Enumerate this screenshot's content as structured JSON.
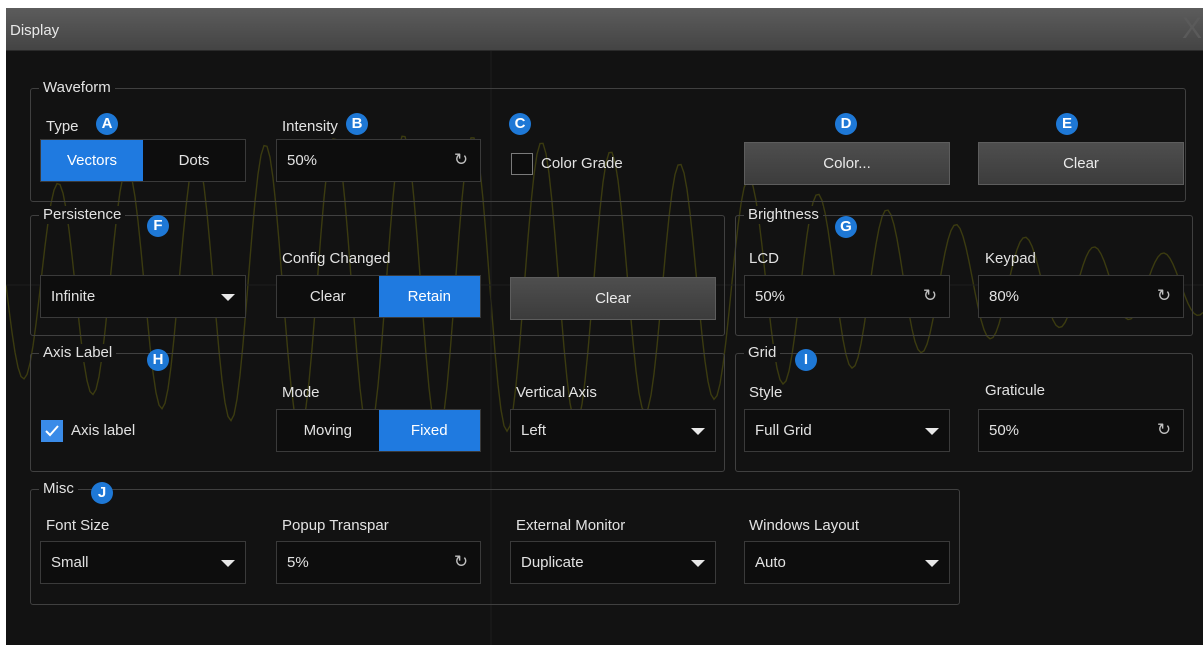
{
  "window": {
    "title": "Display",
    "close_symbol": "X"
  },
  "waveform": {
    "legend": "Waveform",
    "type": {
      "label": "Type",
      "badge": "A",
      "options": [
        "Vectors",
        "Dots"
      ],
      "selected": "Vectors"
    },
    "intensity": {
      "label": "Intensity",
      "badge": "B",
      "value": "50%",
      "icon": "refresh-icon"
    },
    "color_grade": {
      "badge": "C",
      "label": "Color Grade",
      "checked": false
    },
    "color_button": {
      "badge": "D",
      "label": "Color..."
    },
    "clear_button": {
      "badge": "E",
      "label": "Clear"
    }
  },
  "persistence": {
    "legend": "Persistence",
    "badge": "F",
    "dropdown_value": "Infinite",
    "config_changed": {
      "label": "Config Changed",
      "options": [
        "Clear",
        "Retain"
      ],
      "selected": "Retain"
    },
    "clear_button": "Clear"
  },
  "brightness": {
    "legend": "Brightness",
    "badge": "G",
    "lcd": {
      "label": "LCD",
      "value": "50%"
    },
    "keypad": {
      "label": "Keypad",
      "value": "80%"
    }
  },
  "axis_label": {
    "legend": "Axis Label",
    "badge": "H",
    "checkbox": {
      "label": "Axis label",
      "checked": true
    },
    "mode": {
      "label": "Mode",
      "options": [
        "Moving",
        "Fixed"
      ],
      "selected": "Fixed"
    },
    "vertical_axis": {
      "label": "Vertical Axis",
      "value": "Left"
    }
  },
  "grid": {
    "legend": "Grid",
    "badge": "I",
    "style": {
      "label": "Style",
      "value": "Full Grid"
    },
    "graticule": {
      "label": "Graticule",
      "value": "50%"
    }
  },
  "misc": {
    "legend": "Misc",
    "badge": "J",
    "font_size": {
      "label": "Font Size",
      "value": "Small"
    },
    "popup_transparency": {
      "label": "Popup Transpar",
      "value": "5%"
    },
    "external_monitor": {
      "label": "External Monitor",
      "value": "Duplicate"
    },
    "windows_layout": {
      "label": "Windows Layout",
      "value": "Auto"
    }
  },
  "colors": {
    "accent": "#1f7ae0",
    "badge": "#1e78d6",
    "background": "#121212",
    "waveform_trace": "#3b3b10"
  }
}
